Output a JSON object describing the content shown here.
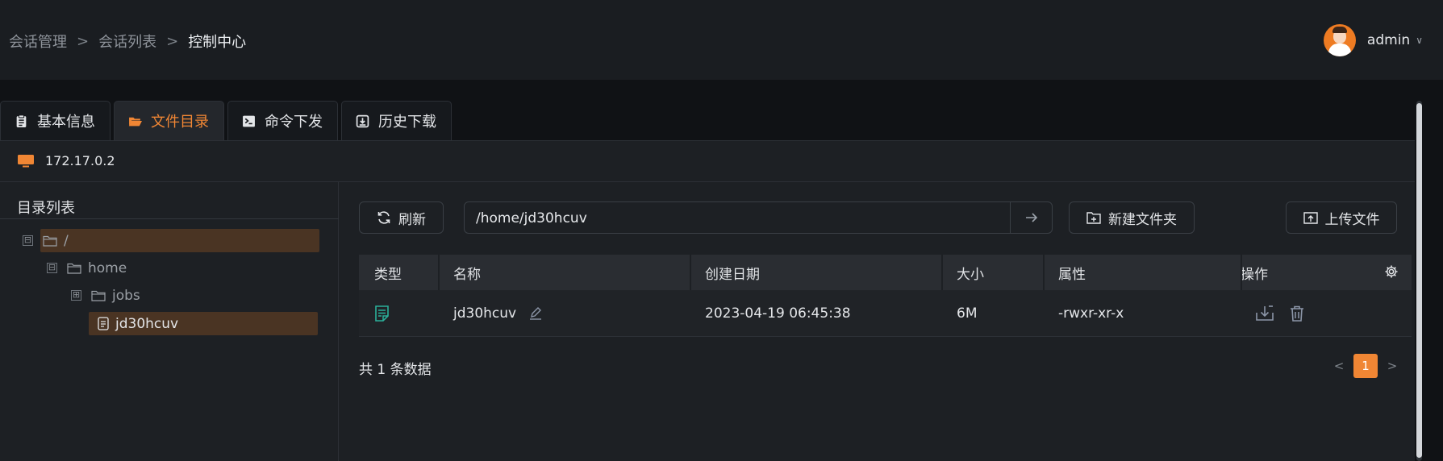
{
  "breadcrumb": [
    "会话管理",
    "会话列表",
    "控制中心"
  ],
  "breadcrumb_separator": ">",
  "user": {
    "name": "admin"
  },
  "tabs": [
    {
      "label": "基本信息",
      "icon": "clipboard-icon",
      "active": false
    },
    {
      "label": "文件目录",
      "icon": "folder-open-icon",
      "active": true
    },
    {
      "label": "命令下发",
      "icon": "terminal-icon",
      "active": false
    },
    {
      "label": "历史下载",
      "icon": "download-box-icon",
      "active": false
    }
  ],
  "host": {
    "ip": "172.17.0.2",
    "icon": "monitor-icon"
  },
  "directory": {
    "title": "目录列表",
    "tree": [
      {
        "label": "/",
        "toggle": "⊟",
        "type": "folder",
        "selected": true
      },
      {
        "label": "home",
        "toggle": "⊟",
        "type": "folder",
        "selected": false
      },
      {
        "label": "jobs",
        "toggle": "⊞",
        "type": "folder",
        "selected": false
      },
      {
        "label": "jd30hcuv",
        "toggle": "",
        "type": "file",
        "selected": true
      }
    ]
  },
  "toolbar": {
    "refresh_label": "刷新",
    "path_value": "/home/jd30hcuv",
    "new_folder_label": "新建文件夹",
    "upload_label": "上传文件"
  },
  "table": {
    "columns": [
      "类型",
      "名称",
      "创建日期",
      "大小",
      "属性",
      "操作"
    ],
    "rows": [
      {
        "type_icon": "file-doc-icon",
        "name": "jd30hcuv",
        "created": "2023-04-19 06:45:38",
        "size": "6M",
        "attrs": "-rwxr-xr-x"
      }
    ]
  },
  "footer": {
    "total_text": "共 1 条数据",
    "current_page": "1"
  },
  "colors": {
    "accent": "#f08634",
    "file_icon": "#2ab09a",
    "background": "#101215",
    "panel": "#1d2024"
  }
}
